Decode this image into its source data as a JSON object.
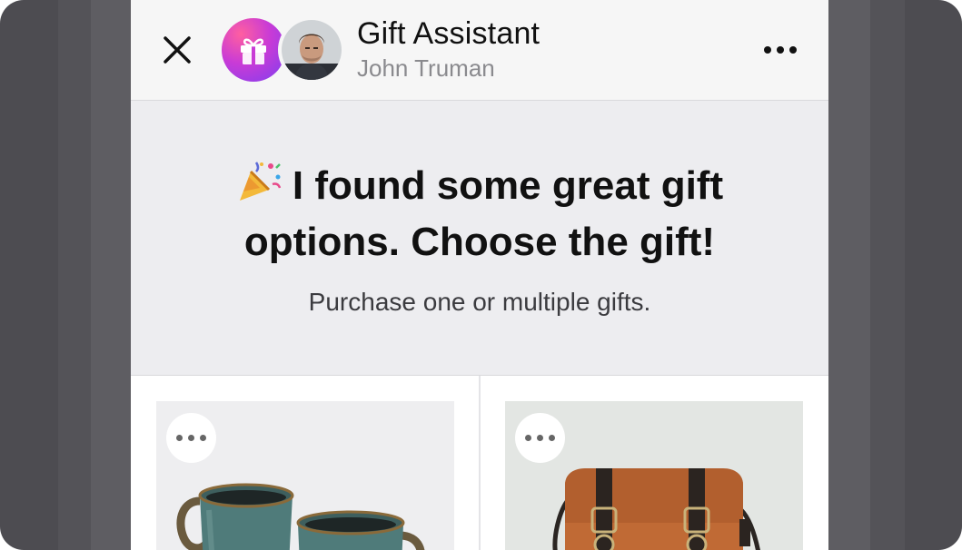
{
  "header": {
    "title": "Gift Assistant",
    "subtitle": "John Truman",
    "close_icon": "close-icon",
    "more_icon": "more-horizontal-icon"
  },
  "hero": {
    "emoji_icon": "party-popper-icon",
    "headline": "I found some great gift options. Choose the gift!",
    "subtext": "Purchase one or multiple gifts."
  },
  "products": [
    {
      "icon": "mugs-image",
      "more_icon": "more-horizontal-icon"
    },
    {
      "icon": "leather-bag-image",
      "more_icon": "more-horizontal-icon"
    }
  ],
  "colors": {
    "gift_gradient_start": "#ff5fa0",
    "gift_gradient_end": "#7d3ef0",
    "header_bg": "#f6f6f6",
    "hero_bg": "#ededf0"
  }
}
